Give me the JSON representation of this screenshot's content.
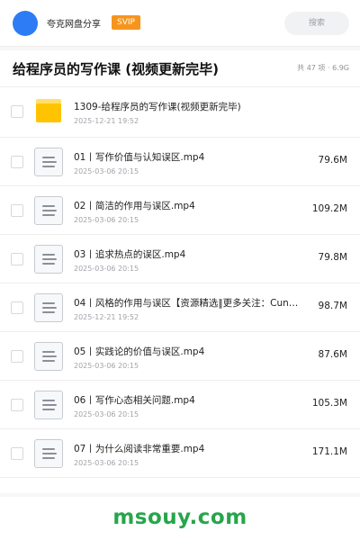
{
  "header": {
    "account_name": "夸克网盘分享",
    "badge": "SVIP",
    "search_placeholder": "搜索"
  },
  "share": {
    "title": "给程序员的写作课 (视频更新完毕)",
    "meta": "共 47 项 · 6.9G"
  },
  "files": [
    {
      "type": "folder",
      "name": "1309-给程序员的写作课(视频更新完毕)",
      "date": "2025-12-21 19:52",
      "size": ""
    },
    {
      "type": "file",
      "name": "01丨写作价值与认知误区.mp4",
      "date": "2025-03-06 20:15",
      "size": "79.6M"
    },
    {
      "type": "file",
      "name": "02丨简洁的作用与误区.mp4",
      "date": "2025-03-06 20:15",
      "size": "109.2M"
    },
    {
      "type": "file",
      "name": "03丨追求热点的误区.mp4",
      "date": "2025-03-06 20:15",
      "size": "79.8M"
    },
    {
      "type": "file",
      "name": "04丨风格的作用与误区【资源精选‖更多关注：Cun…",
      "date": "2025-12-21 19:52",
      "size": "98.7M"
    },
    {
      "type": "file",
      "name": "05丨实践论的价值与误区.mp4",
      "date": "2025-03-06 20:15",
      "size": "87.6M"
    },
    {
      "type": "file",
      "name": "06丨写作心态相关问题.mp4",
      "date": "2025-03-06 20:15",
      "size": "105.3M"
    },
    {
      "type": "file",
      "name": "07丨为什么阅读非常重要.mp4",
      "date": "2025-03-06 20:15",
      "size": "171.1M"
    }
  ],
  "watermark": "msouy.com",
  "colors": {
    "avatar": "#2d7cf6",
    "svip_badge": "#f7941e",
    "folder": "#ffc300",
    "watermark": "#27a54b"
  },
  "icons": {
    "folder": "folder-icon",
    "file": "video-file-icon"
  }
}
